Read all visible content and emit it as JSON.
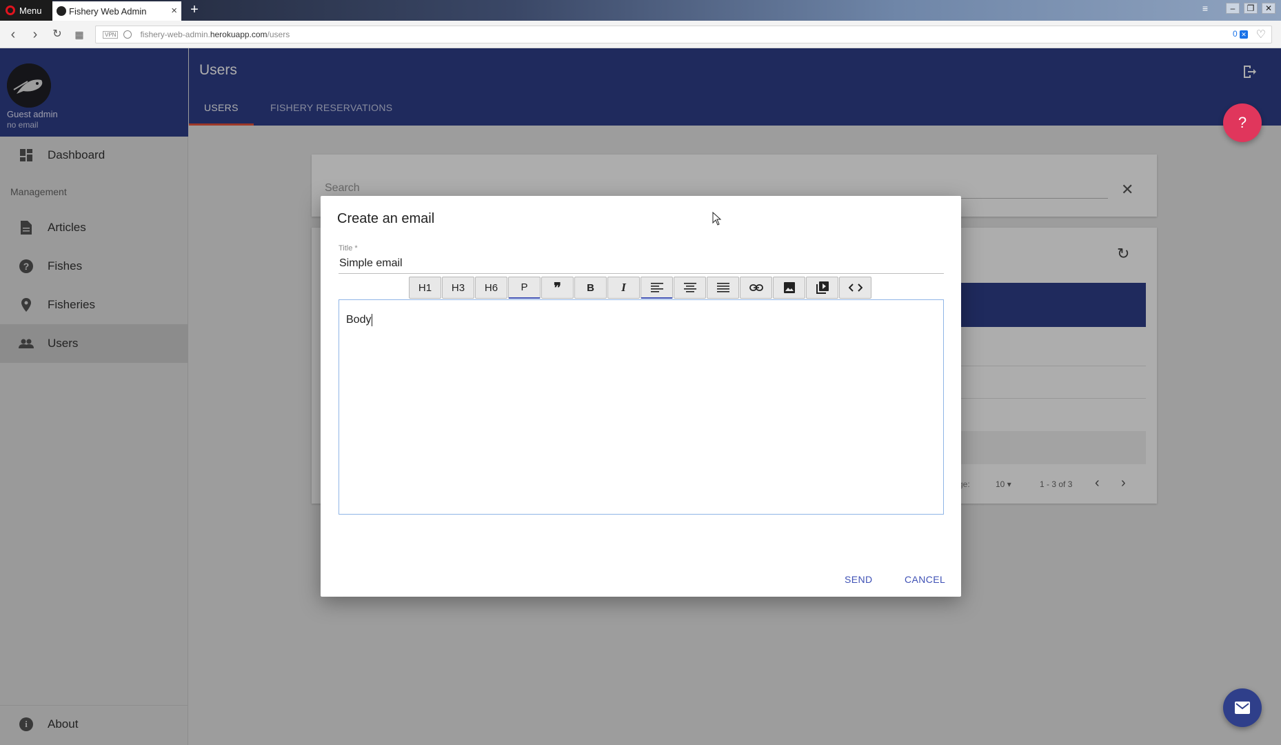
{
  "browser": {
    "menu_label": "Menu",
    "tab_title": "Fishery Web Admin",
    "tab_close": "×",
    "new_tab": "+",
    "url_prefix": "fishery-web-admin.",
    "url_host": "herokuapp.com",
    "url_path": "/users",
    "vpn_label": "VPN",
    "adblock_count": "0"
  },
  "sidebar": {
    "user_name": "Guest admin",
    "user_email": "no email",
    "dashboard_label": "Dashboard",
    "section_label": "Management",
    "items": [
      {
        "label": "Articles",
        "icon": "article-icon"
      },
      {
        "label": "Fishes",
        "icon": "help-circle-icon"
      },
      {
        "label": "Fisheries",
        "icon": "location-pin-icon"
      },
      {
        "label": "Users",
        "icon": "people-icon",
        "active": true
      }
    ],
    "about_label": "About"
  },
  "appbar": {
    "title": "Users",
    "tabs": [
      {
        "label": "USERS",
        "active": true
      },
      {
        "label": "FISHERY RESERVATIONS",
        "active": false
      }
    ],
    "help_icon": "?"
  },
  "background": {
    "search_placeholder": "Search",
    "clear_icon": "✕",
    "rows_per_page_label": "ge:",
    "rows_per_page": "10",
    "page_range": "1 - 3 of 3"
  },
  "dialog": {
    "title": "Create an email",
    "title_field_label": "Title *",
    "title_field_value": "Simple email",
    "toolbar": [
      "H1",
      "H3",
      "H6",
      "P",
      "❞",
      "B",
      "I"
    ],
    "body_text": "Body",
    "send_label": "SEND",
    "cancel_label": "CANCEL"
  },
  "colors": {
    "primary": "#2f3f8a",
    "accent": "#e0365c",
    "tab_indicator": "#e8533c",
    "button_text": "#3f51b5"
  }
}
